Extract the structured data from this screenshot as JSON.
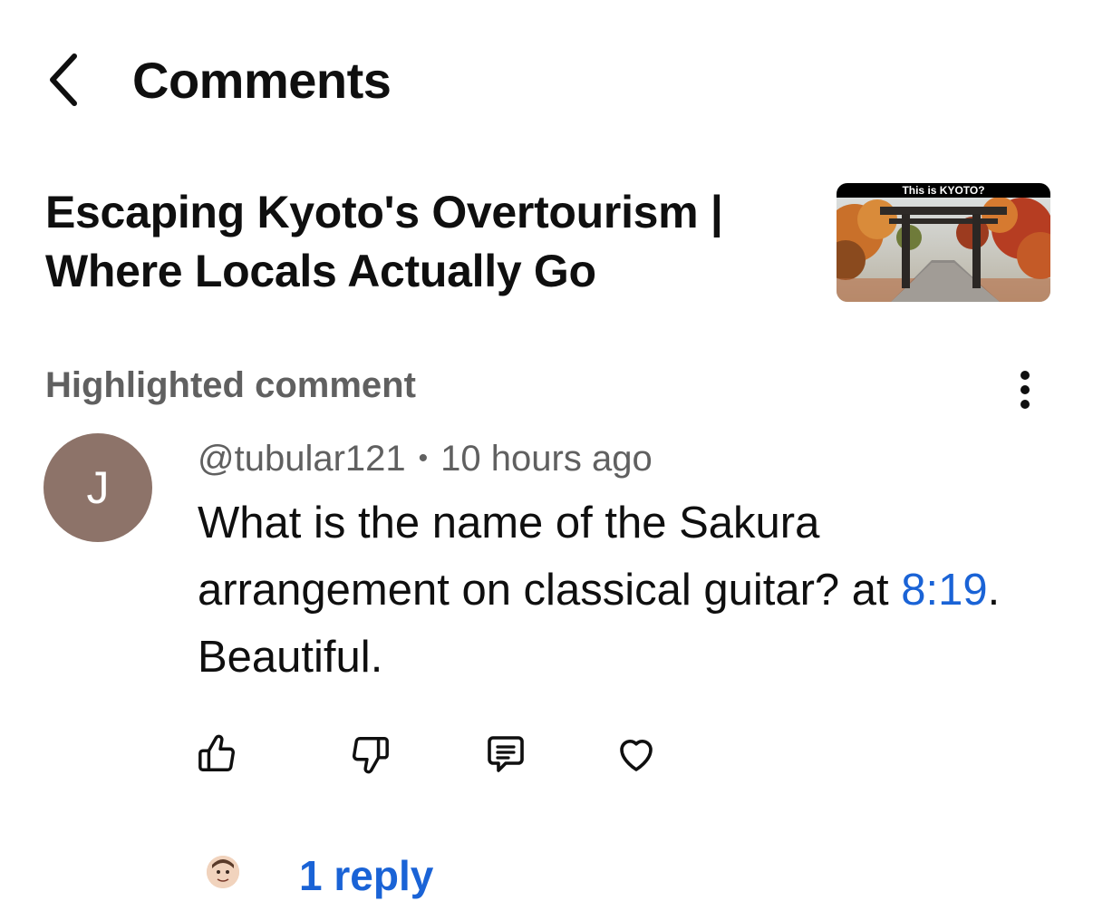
{
  "header": {
    "title": "Comments",
    "back_icon": "chevron-left-icon"
  },
  "video": {
    "title": "Escaping Kyoto's Overtourism | Where Locals Actually Go",
    "thumbnail_caption": "This is KYOTO?"
  },
  "highlighted": {
    "label": "Highlighted comment",
    "more_icon": "more-vertical-icon"
  },
  "comment": {
    "avatar_letter": "J",
    "avatar_color": "#8d7369",
    "author": "@tubular121",
    "separator": "•",
    "time": "10 hours ago",
    "text_before": "What is the name of the Sakura arrangement on classical guitar? at ",
    "timestamp": "8:19",
    "text_after": ". Beautiful."
  },
  "actions": {
    "like_icon": "thumbs-up-icon",
    "dislike_icon": "thumbs-down-icon",
    "reply_icon": "comment-icon",
    "heart_icon": "heart-icon"
  },
  "replies": {
    "label": "1 reply"
  },
  "colors": {
    "link": "#1a63d6",
    "secondary_text": "#606060",
    "primary_text": "#0f0f0f"
  }
}
